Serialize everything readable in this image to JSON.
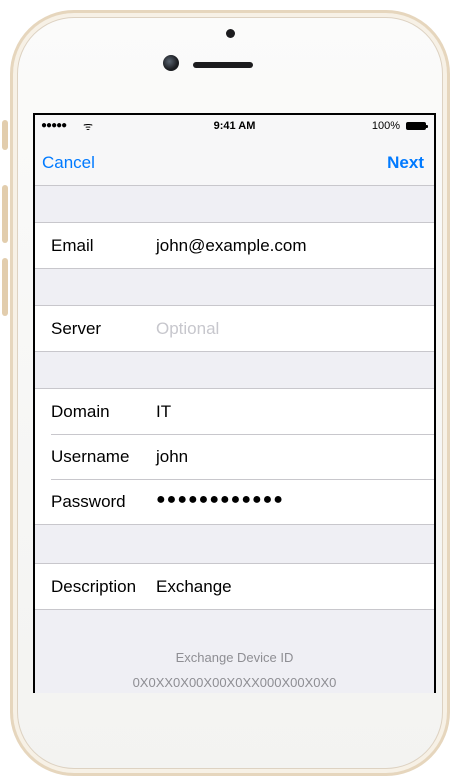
{
  "status_bar": {
    "signal": "●●●●●",
    "wifi": "ᯤ",
    "time": "9:41 AM",
    "battery": "100%"
  },
  "nav": {
    "cancel": "Cancel",
    "next": "Next"
  },
  "account": {
    "email_label": "Email",
    "email_value": "john@example.com",
    "server_label": "Server",
    "server_placeholder": "Optional",
    "domain_label": "Domain",
    "domain_value": "IT",
    "username_label": "Username",
    "username_value": "john",
    "password_label": "Password",
    "password_value": "●●●●●●●●●●●●",
    "description_label": "Description",
    "description_value": "Exchange"
  },
  "footer": {
    "device_id_label": "Exchange Device ID",
    "device_id_value": "0X0XX0X00X00X0XX000X00X0X0"
  },
  "colors": {
    "accent": "#007aff",
    "background": "#efeff4",
    "phone_bezel": "#e6d6bd"
  }
}
